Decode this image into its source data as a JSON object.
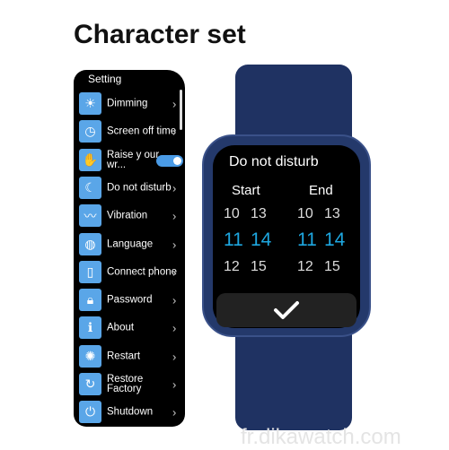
{
  "title": "Character set",
  "settings": {
    "header": "Setting",
    "items": [
      {
        "label": "Dimming",
        "icon": "brightness-icon",
        "control": "chevron"
      },
      {
        "label": "Screen off time",
        "icon": "clock-icon",
        "control": "chevron"
      },
      {
        "label": "Raise y our wr...",
        "icon": "wrist-icon",
        "control": "toggle",
        "toggle_on": true
      },
      {
        "label": "Do not disturb",
        "icon": "moon-icon",
        "control": "chevron"
      },
      {
        "label": "Vibration",
        "icon": "vibration-icon",
        "control": "chevron"
      },
      {
        "label": "Language",
        "icon": "globe-icon",
        "control": "chevron"
      },
      {
        "label": "Connect phone",
        "icon": "connect-phone-icon",
        "control": "chevron"
      },
      {
        "label": "Password",
        "icon": "lock-icon",
        "control": "chevron"
      },
      {
        "label": "About",
        "icon": "info-icon",
        "control": "chevron"
      },
      {
        "label": "Restart",
        "icon": "restart-icon",
        "control": "chevron"
      },
      {
        "label": "Restore Factory",
        "icon": "restore-icon",
        "control": "chevron"
      },
      {
        "label": "Shutdown",
        "icon": "power-icon",
        "control": "chevron"
      }
    ]
  },
  "watch": {
    "title": "Do not disturb",
    "start": {
      "label": "Start",
      "values": [
        "10",
        "13",
        "11",
        "14",
        "12",
        "15"
      ]
    },
    "end": {
      "label": "End",
      "values": [
        "10",
        "13",
        "11",
        "14",
        "12",
        "15"
      ]
    },
    "confirm_icon": "checkmark-icon",
    "accent": "#1ea7e0",
    "band_color": "#1f3262"
  },
  "watermark": "fr.dikawatch.com"
}
